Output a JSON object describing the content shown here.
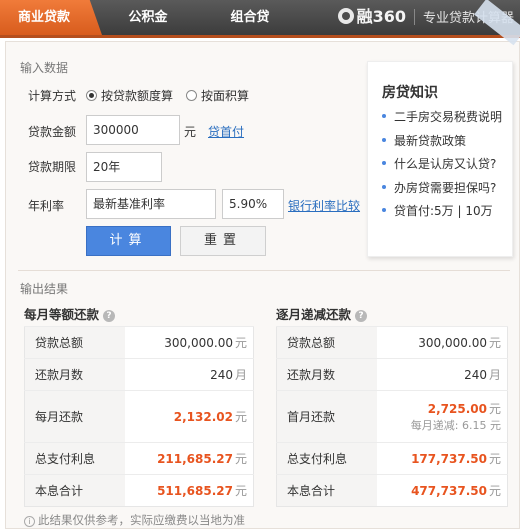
{
  "tabs": [
    {
      "label": "商业贷款"
    },
    {
      "label": "公积金"
    },
    {
      "label": "组合贷"
    }
  ],
  "brand": {
    "logo": "融360",
    "subtitle": "专业贷款计算器"
  },
  "input": {
    "section_label": "输入数据",
    "method_label": "计算方式",
    "method_options": [
      "按贷款额度算",
      "按面积算"
    ],
    "amount_label": "贷款金额",
    "amount_value": "300000",
    "amount_unit": "元",
    "down_payment_link": "贷首付",
    "term_label": "贷款期限",
    "term_value": "20年",
    "rate_label": "年利率",
    "rate_type": "最新基准利率",
    "rate_value": "5.90%",
    "rate_compare_link": "银行利率比较",
    "calc_button": "计算",
    "reset_button": "重置"
  },
  "knowledge": {
    "title": "房贷知识",
    "items": [
      "二手房交易税费说明",
      "最新贷款政策",
      "什么是认房又认贷?",
      "办房贷需要担保吗?",
      "贷首付:5万 | 10万"
    ]
  },
  "output": {
    "section_label": "输出结果",
    "equal_payment": {
      "title": "每月等额还款",
      "rows": [
        {
          "label": "贷款总额",
          "value": "300,000.00",
          "unit": "元"
        },
        {
          "label": "还款月数",
          "value": "240",
          "unit": "月"
        },
        {
          "label": "每月还款",
          "value": "2,132.02",
          "unit": "元"
        },
        {
          "label": "总支付利息",
          "value": "211,685.27",
          "unit": "元"
        },
        {
          "label": "本息合计",
          "value": "511,685.27",
          "unit": "元"
        }
      ]
    },
    "equal_principal": {
      "title": "逐月递减还款",
      "rows": [
        {
          "label": "贷款总额",
          "value": "300,000.00",
          "unit": "元"
        },
        {
          "label": "还款月数",
          "value": "240",
          "unit": "月"
        },
        {
          "label": "首月还款",
          "value": "2,725.00",
          "unit": "元"
        },
        {
          "label": "总支付利息",
          "value": "177,737.50",
          "unit": "元"
        },
        {
          "label": "本息合计",
          "value": "477,737.50",
          "unit": "元"
        }
      ],
      "monthly_decrease_label": "每月递减:",
      "monthly_decrease_value": "6.15",
      "monthly_decrease_unit": "元"
    },
    "disclaimer": "此结果仅供参考，实际应缴费以当地为准"
  },
  "colors": {
    "accent": "#e8541f",
    "tab_active": "#e8692b",
    "button_blue": "#4a86df",
    "link": "#2a6ebf"
  }
}
